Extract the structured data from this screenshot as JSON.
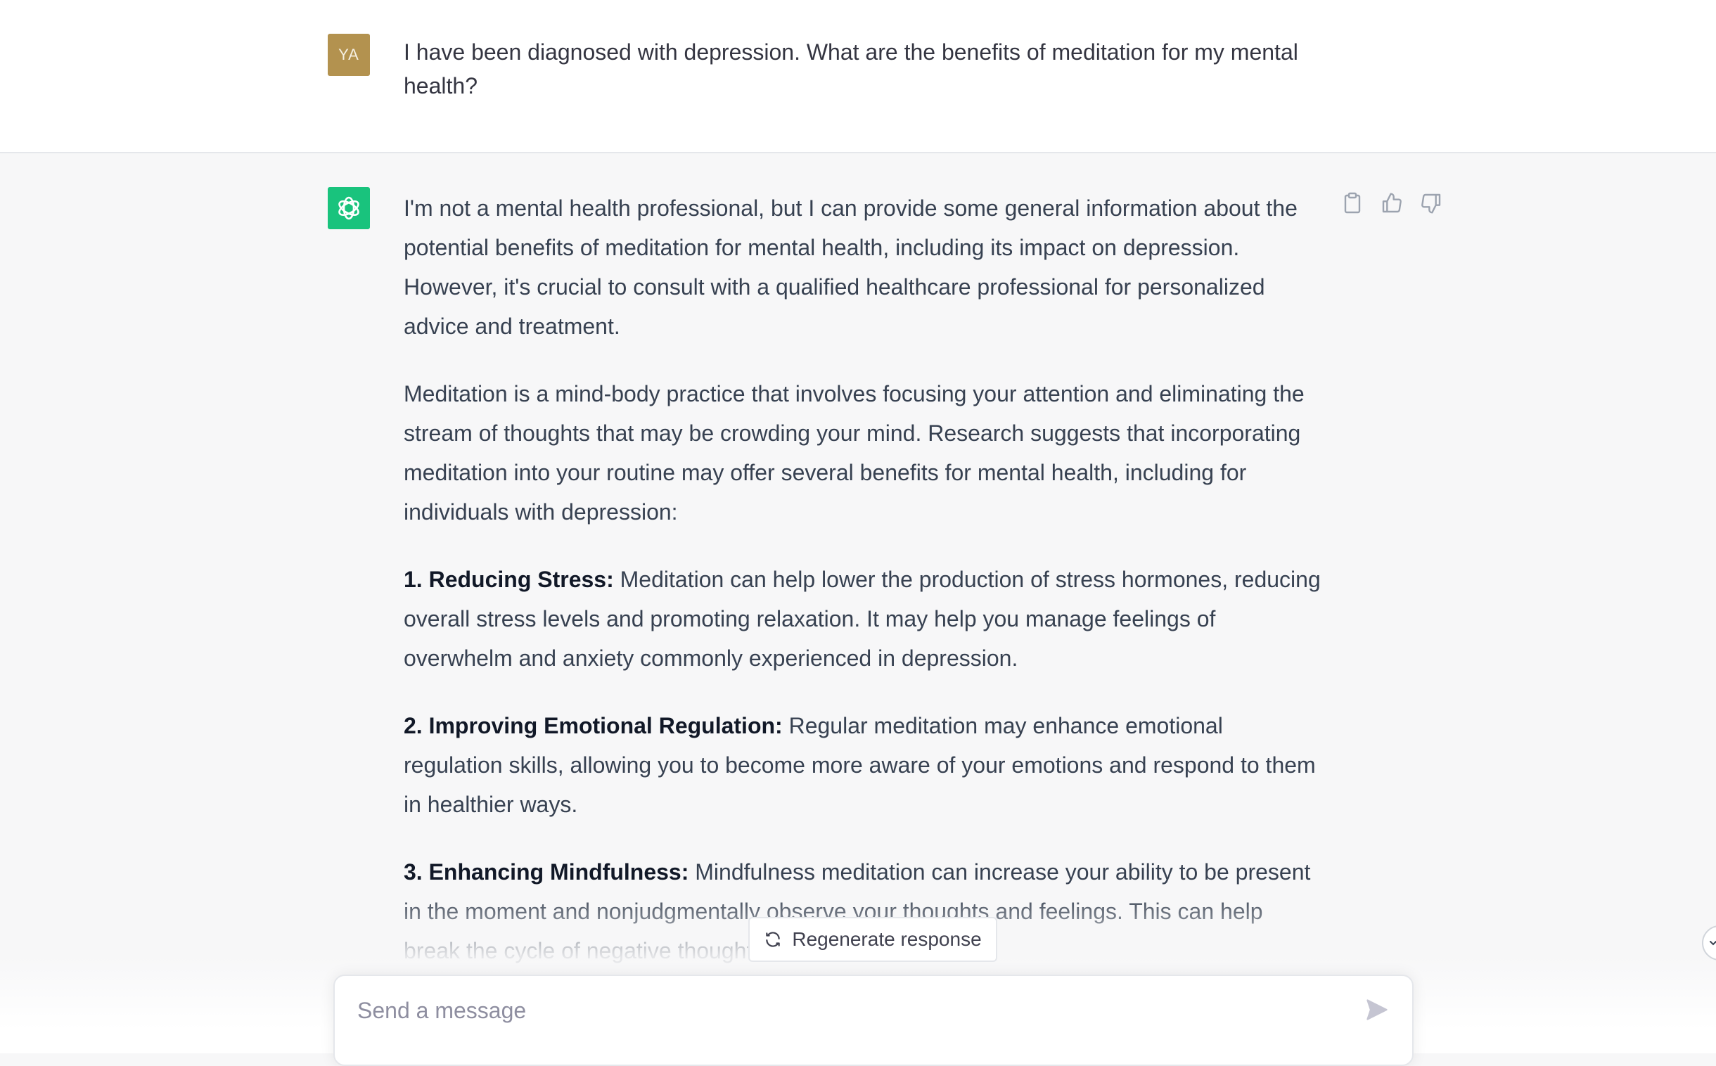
{
  "user_message": {
    "avatar_initials": "YA",
    "avatar_color": "#b3924f",
    "text": "I have been diagnosed with depression. What are the benefits of meditation for my mental health?"
  },
  "assistant_message": {
    "avatar_color": "#19c37d",
    "avatar_icon": "openai-logo-icon",
    "paragraphs": [
      "I'm not a mental health professional, but I can provide some general information about the potential benefits of meditation for mental health, including its impact on depression. However, it's crucial to consult with a qualified healthcare professional for personalized advice and treatment.",
      "Meditation is a mind-body practice that involves focusing your attention and eliminating the stream of thoughts that may be crowding your mind. Research suggests that incorporating meditation into your routine may offer several benefits for mental health, including for individuals with depression:"
    ],
    "list_items": [
      {
        "heading": "1. Reducing Stress:",
        "text": "Meditation can help lower the production of stress hormones, reducing overall stress levels and promoting relaxation. It may help you manage feelings of overwhelm and anxiety commonly experienced in depression."
      },
      {
        "heading": "2. Improving Emotional Regulation:",
        "text": "Regular meditation may enhance emotional regulation skills, allowing you to become more aware of your emotions and respond to them in healthier ways."
      },
      {
        "heading": "3. Enhancing Mindfulness:",
        "text": "Mindfulness meditation can increase your ability to be present in the moment and nonjudgmentally observe your thoughts and feelings. This can help break the cycle of negative thoughts asso"
      }
    ],
    "actions": [
      "clipboard-icon",
      "thumbs-up-icon",
      "thumbs-down-icon"
    ]
  },
  "regenerate_button": {
    "label": "Regenerate response",
    "icon": "refresh-icon"
  },
  "composer": {
    "placeholder": "Send a message",
    "send_icon": "send-icon"
  },
  "scroll_button": {
    "icon": "chevron-down-icon"
  }
}
